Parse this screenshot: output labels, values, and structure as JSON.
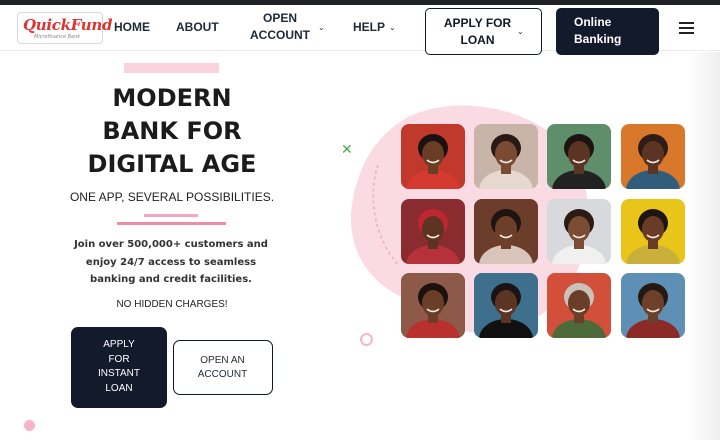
{
  "brand": {
    "logo_text": "QuickFund",
    "logo_subtext": "Microfinance Bank"
  },
  "nav": {
    "home": "HOME",
    "about": "ABOUT",
    "open_account": "OPEN\nACCOUNT",
    "help": "HELP",
    "apply_for_loan": "APPLY FOR\nLOAN",
    "online_banking": "Online\nBanking"
  },
  "hero": {
    "title": "MODERN\nBANK FOR\nDIGITAL AGE",
    "subtitle": "ONE APP, SEVERAL POSSIBILITIES.",
    "body": "Join over 500,000+ customers and enjoy 24/7 access to seamless banking and credit facilities.",
    "note": "NO HIDDEN CHARGES!",
    "cta_primary": "APPLY\nFOR\nINSTANT\nLOAN",
    "cta_secondary": "OPEN AN\nACCOUNT"
  },
  "icons": {
    "caret": "chevron-down-icon",
    "menu": "hamburger-menu-icon",
    "decor_x": "close-icon"
  },
  "colors": {
    "primary_dark": "#121a2c",
    "accent_pink": "#ec8ea4",
    "brand_red": "#e0322e",
    "blob_pink": "#fbdbe3"
  },
  "gallery": [
    {
      "name": "photo-woman-curly-hair-red-top",
      "bg": "#c0392b",
      "skin": "#6b3d25",
      "hair": "#1a1110",
      "cloth": "#d43a2f"
    },
    {
      "name": "photo-mother-kissing-baby",
      "bg": "#c8b4a8",
      "skin": "#7a4a33",
      "hair": "#2a1a14",
      "cloth": "#e6d8cf"
    },
    {
      "name": "photo-smiling-woman-braids",
      "bg": "#5f8f6a",
      "skin": "#5a3524",
      "hair": "#1c1412",
      "cloth": "#222222"
    },
    {
      "name": "photo-young-man-orange-background",
      "bg": "#d9772b",
      "skin": "#5b3423",
      "hair": "#2e1d16",
      "cloth": "#2f5d7a"
    },
    {
      "name": "photo-woman-headwrap",
      "bg": "#8a2b2f",
      "skin": "#5e3322",
      "hair": "#c0262f",
      "cloth": "#b5323a"
    },
    {
      "name": "photo-laughing-woman",
      "bg": "#6b3d2a",
      "skin": "#6e3f28",
      "hair": "#1e1411",
      "cloth": "#d8c4b8"
    },
    {
      "name": "photo-father-with-child",
      "bg": "#d7d9dc",
      "skin": "#7b4c33",
      "hair": "#2a1c15",
      "cloth": "#f0f0f0"
    },
    {
      "name": "photo-man-hand-on-face-yellow",
      "bg": "#e9c51a",
      "skin": "#6a3c25",
      "hair": "#1d1511",
      "cloth": "#c9b03a"
    },
    {
      "name": "photo-two-women-selfie",
      "bg": "#8d5a4a",
      "skin": "#6b3e27",
      "hair": "#1b1210",
      "cloth": "#b8312f"
    },
    {
      "name": "photo-woman-blue-background",
      "bg": "#3e6f8c",
      "skin": "#5b3423",
      "hair": "#1c1412",
      "cloth": "#111111"
    },
    {
      "name": "photo-older-man-red-background",
      "bg": "#d2503a",
      "skin": "#6a3e28",
      "hair": "#c9c2b8",
      "cloth": "#4d6b3a"
    },
    {
      "name": "photo-man-glasses-praying-hands",
      "bg": "#5e8fb4",
      "skin": "#6d4029",
      "hair": "#241913",
      "cloth": "#8c2b25"
    }
  ]
}
